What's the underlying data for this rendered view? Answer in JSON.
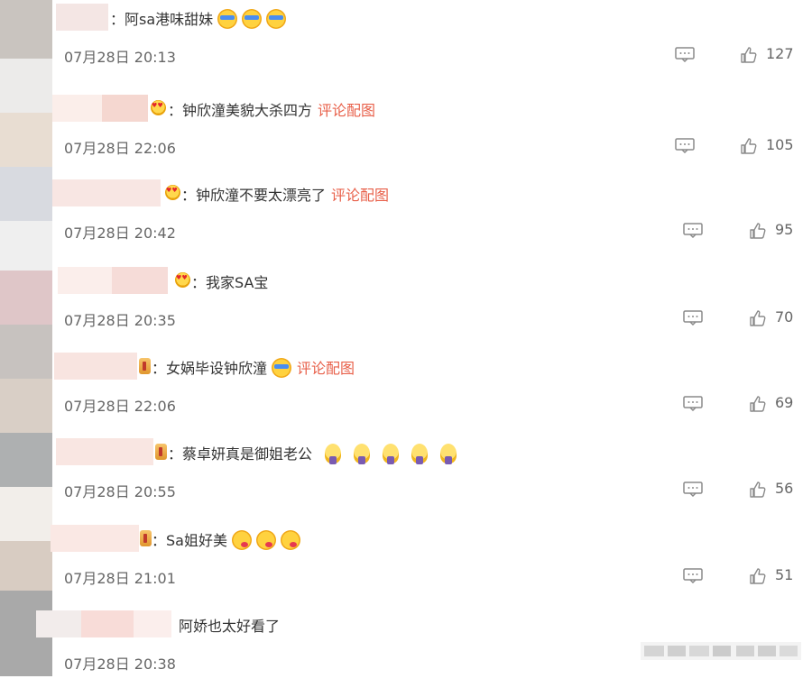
{
  "colors": {
    "text": "#333333",
    "meta": "#666666",
    "link": "#e8604a",
    "icon": "#8a8a8a"
  },
  "comments": [
    {
      "text": "阿sa港味甜妹",
      "badge": "none",
      "emojis": [
        "cool-sunglasses-emoji",
        "cool-sunglasses-emoji",
        "cool-sunglasses-emoji"
      ],
      "pic_link": "",
      "date": "07月28日 20:13",
      "likes": "127"
    },
    {
      "text": "钟欣潼美貌大杀四方",
      "badge": "heart-eyes-badge",
      "emojis": [],
      "pic_link": "评论配图",
      "date": "07月28日 22:06",
      "likes": "105"
    },
    {
      "text": "钟欣潼不要太漂亮了",
      "badge": "heart-eyes-badge",
      "emojis": [],
      "pic_link": "评论配图",
      "date": "07月28日 20:42",
      "likes": "95"
    },
    {
      "text": "我家SA宝",
      "badge": "heart-eyes-badge",
      "emojis": [],
      "pic_link": "",
      "date": "07月28日 20:35",
      "likes": "70"
    },
    {
      "text": "女娲毕设钟欣潼",
      "badge": "crown-badge",
      "emojis": [
        "cool-sunglasses-emoji"
      ],
      "pic_link": "评论配图",
      "date": "07月28日 22:06",
      "likes": "69"
    },
    {
      "text": "蔡卓妍真是御姐老公",
      "badge": "crown-badge",
      "emojis": [
        "lightbulb-emoji",
        "lightbulb-emoji",
        "lightbulb-emoji",
        "lightbulb-emoji",
        "lightbulb-emoji"
      ],
      "pic_link": "",
      "date": "07月28日 20:55",
      "likes": "56"
    },
    {
      "text": "Sa姐好美",
      "badge": "crown-badge",
      "emojis": [
        "kiss-emoji",
        "kiss-emoji",
        "kiss-emoji"
      ],
      "pic_link": "",
      "date": "07月28日 21:01",
      "likes": "51"
    },
    {
      "text": "阿娇也太好看了",
      "badge": "none",
      "emojis": [],
      "pic_link": "",
      "date": "07月28日 20:38",
      "likes": ""
    }
  ]
}
